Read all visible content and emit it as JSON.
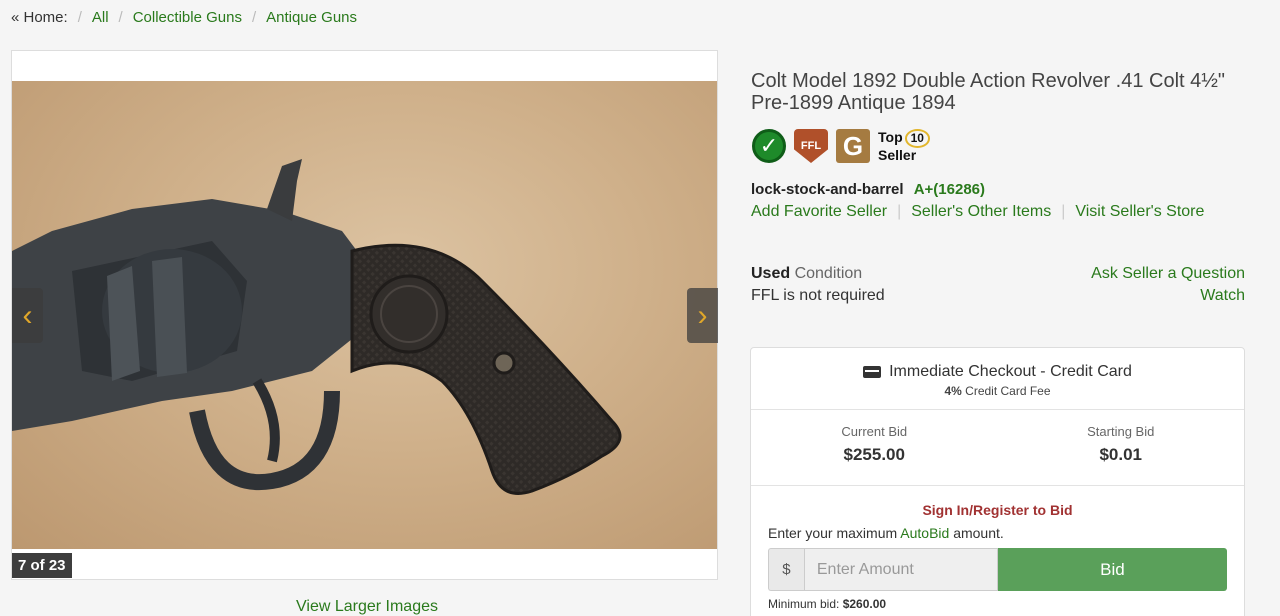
{
  "breadcrumb": {
    "home": "« Home:",
    "items": [
      "All",
      "Collectible Guns",
      "Antique Guns"
    ],
    "separator": "/"
  },
  "gallery": {
    "counter": "7 of 23",
    "prev_icon": "chevron-left-icon",
    "next_icon": "chevron-right-icon",
    "view_larger": "View Larger Images"
  },
  "listing": {
    "title": "Colt Model 1892 Double Action Revolver .41 Colt 4½\" Pre-1899 Antique 1894"
  },
  "badges": {
    "check_icon": "verified-check-icon",
    "ffl": "FFL",
    "g": "G",
    "top": "Top",
    "ten": "10",
    "seller": "Seller"
  },
  "seller": {
    "name": "lock-stock-and-barrel",
    "rating": "A+(16286)",
    "links": [
      "Add Favorite Seller",
      "Seller's Other Items",
      "Visit Seller's Store"
    ]
  },
  "condition": {
    "label": "Used",
    "word": "Condition",
    "ffl": "FFL is not required"
  },
  "actions": {
    "ask": "Ask Seller a Question",
    "watch": "Watch"
  },
  "checkout": {
    "icon": "credit-card-icon",
    "title": "Immediate Checkout - Credit Card",
    "fee_pct": "4%",
    "fee_text": "Credit Card Fee"
  },
  "bids": {
    "current_label": "Current Bid",
    "current_value": "$255.00",
    "starting_label": "Starting Bid",
    "starting_value": "$0.01"
  },
  "bid_form": {
    "signin": "Sign In/Register to Bid",
    "autobid_pre": "Enter your maximum ",
    "autobid_link": "AutoBid",
    "autobid_post": " amount.",
    "currency": "$",
    "placeholder": "Enter Amount",
    "button": "Bid",
    "min_label": "Minimum bid:",
    "min_value": "$260.00"
  },
  "colors": {
    "link_green": "#2a7a1c",
    "bid_button": "#5aa05a",
    "signin_red": "#a13232",
    "arrow_gold": "#e0a72a"
  }
}
